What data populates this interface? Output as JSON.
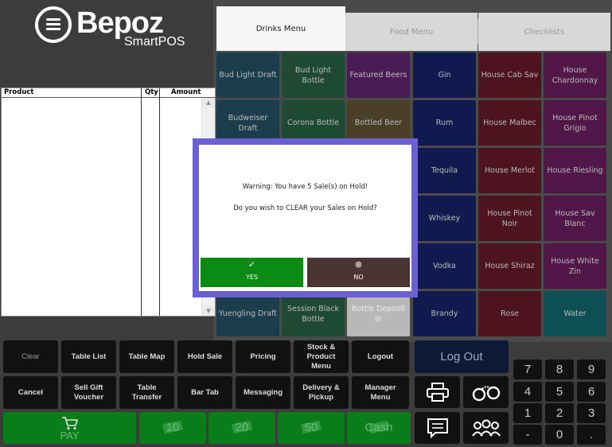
{
  "logo": {
    "name": "Bepoz",
    "sub": "SmartPOS"
  },
  "tabs": [
    "Drinks Menu",
    "Food Menu",
    "Checklists"
  ],
  "order_table": {
    "columns": [
      "Product",
      "Qty",
      "Amount"
    ]
  },
  "menu_buttons": [
    {
      "label": "Bud Light Draft",
      "color": "#1b3d4e"
    },
    {
      "label": "Bud Light Bottle",
      "color": "#1e4a33"
    },
    {
      "label": "Featured Beers",
      "color": "#4a1c55"
    },
    {
      "label": "Gin",
      "color": "#101a4e"
    },
    {
      "label": "House Cab Sav",
      "color": "#4d1420"
    },
    {
      "label": "House Chardonnay",
      "color": "#501748"
    },
    {
      "label": "Budweiser Draft",
      "color": "#1b3d4e"
    },
    {
      "label": "Corona Bottle",
      "color": "#1e4a33"
    },
    {
      "label": "Bottled Beer",
      "color": "#4a4028"
    },
    {
      "label": "Rum",
      "color": "#101a4e"
    },
    {
      "label": "House Malbec",
      "color": "#4d1420"
    },
    {
      "label": "House Pinot Grigio",
      "color": "#501748"
    },
    {
      "label": "",
      "color": "#1b3d4e"
    },
    {
      "label": "",
      "color": "#1e4a33"
    },
    {
      "label": "",
      "color": "#4a4028"
    },
    {
      "label": "Tequila",
      "color": "#101a4e"
    },
    {
      "label": "House Merlot",
      "color": "#4d1420"
    },
    {
      "label": "House Riesling",
      "color": "#501748"
    },
    {
      "label": "",
      "color": "#1b3d4e"
    },
    {
      "label": "",
      "color": "#1e4a33"
    },
    {
      "label": "",
      "color": "#4a4028"
    },
    {
      "label": "Whiskey",
      "color": "#101a4e"
    },
    {
      "label": "House Pinot Noir",
      "color": "#4d1420"
    },
    {
      "label": "House Sav Blanc",
      "color": "#501748"
    },
    {
      "label": "",
      "color": "#1b3d4e"
    },
    {
      "label": "",
      "color": "#1e4a33"
    },
    {
      "label": "",
      "color": "#4a4028"
    },
    {
      "label": "Vodka",
      "color": "#101a4e"
    },
    {
      "label": "House Shiraz",
      "color": "#4d1420"
    },
    {
      "label": "House White Zin",
      "color": "#501748"
    },
    {
      "label": "Yuengling Draft",
      "color": "#1b3d4e"
    },
    {
      "label": "Session Black Bottle",
      "color": "#1e4a33"
    },
    {
      "label": "Bottle Deposit In",
      "color": "#b8b8b8"
    },
    {
      "label": "Brandy",
      "color": "#101a4e"
    },
    {
      "label": "Rose",
      "color": "#4d1420"
    },
    {
      "label": "Water",
      "color": "#0e4f56"
    }
  ],
  "function_buttons": {
    "row1": [
      "Clear",
      "Table List",
      "Table Map",
      "Hold Sale",
      "Pricing",
      "Stock & Product Menu",
      "Logout"
    ],
    "row2": [
      "Cancel",
      "Sell Gift Voucher",
      "Table Transfer",
      "Bar Tab",
      "Messaging",
      "Delivery & Pickup",
      "Manager Menu"
    ]
  },
  "pay_buttons": [
    "PAY",
    "10",
    "20",
    "50",
    "Cash"
  ],
  "logout_big": "Log Out",
  "keypad": [
    "7",
    "8",
    "9",
    "4",
    "5",
    "6",
    "1",
    "2",
    "3",
    "-",
    "0",
    "."
  ],
  "dialog": {
    "warning": "Warning: You have 5 Sale(s) on Hold!",
    "question": "Do you wish to CLEAR your Sales on Hold?",
    "yes": "YES",
    "no": "NO"
  },
  "icons": {
    "printer": "printer-icon",
    "handcuffs": "handcuffs-icon",
    "message": "message-icon",
    "group": "people-group-icon",
    "cart": "shopping-cart-icon",
    "money": "money-icon"
  }
}
